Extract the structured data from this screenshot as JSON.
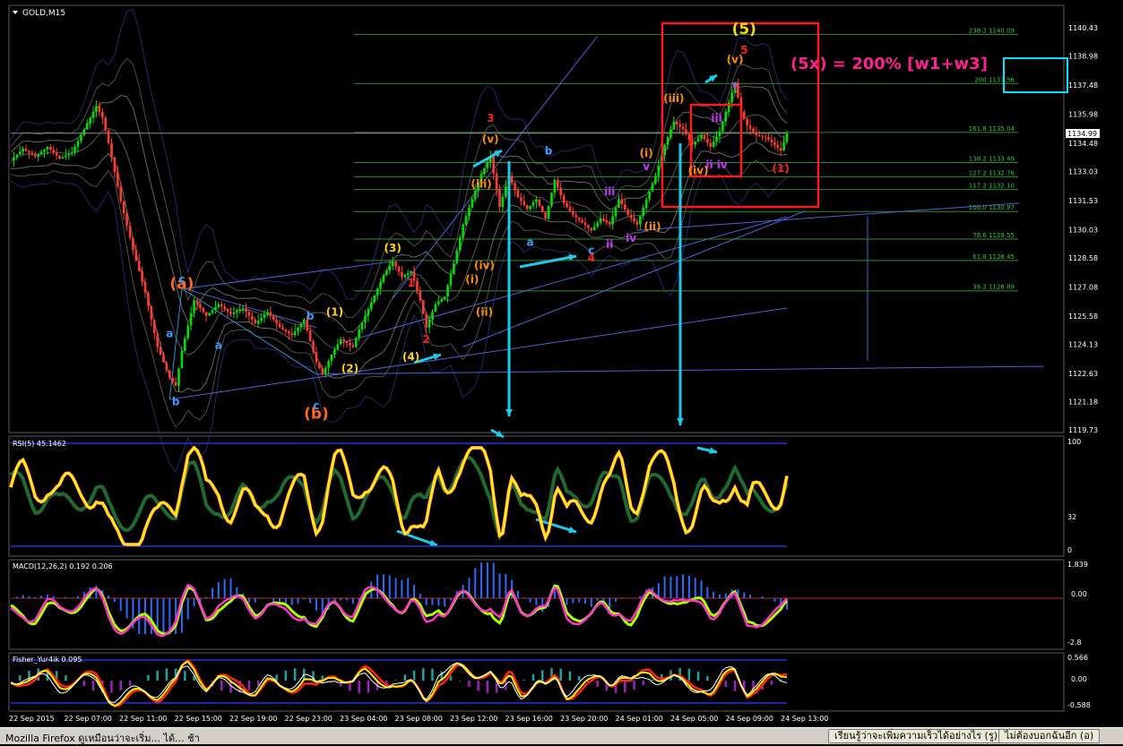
{
  "chart_data": {
    "type": "candlestick",
    "symbol": "GOLD,M15",
    "price_axis": {
      "range": [
        1119.73,
        1140.43
      ],
      "ticks": [
        "1140.43",
        "1138.98",
        "1137.48",
        "1135.98",
        "1134.48",
        "1133.03",
        "1131.53",
        "1130.03",
        "1128.58",
        "1127.08",
        "1125.58",
        "1124.13",
        "1122.63",
        "1121.18",
        "1119.73"
      ],
      "current_price": "1134.99"
    },
    "time_axis": [
      "22 Sep 2015",
      "22 Sep 07:00",
      "22 Sep 11:00",
      "22 Sep 15:00",
      "22 Sep 19:00",
      "22 Sep 23:00",
      "23 Sep 04:00",
      "23 Sep 08:00",
      "23 Sep 12:00",
      "23 Sep 16:00",
      "23 Sep 20:00",
      "24 Sep 01:00",
      "24 Sep 05:00",
      "24 Sep 09:00",
      "24 Sep 13:00"
    ],
    "close_path": [
      [
        0,
        1133.6
      ],
      [
        4,
        1134.2
      ],
      [
        8,
        1133.8
      ],
      [
        12,
        1134.3
      ],
      [
        16,
        1133.7
      ],
      [
        20,
        1134.0
      ],
      [
        24,
        1135.2
      ],
      [
        28,
        1136.4
      ],
      [
        30,
        1135.8
      ],
      [
        32,
        1134.5
      ],
      [
        36,
        1131.5
      ],
      [
        40,
        1129.0
      ],
      [
        44,
        1126.8
      ],
      [
        48,
        1124.0
      ],
      [
        52,
        1122.4
      ],
      [
        54,
        1122.0
      ],
      [
        56,
        1123.8
      ],
      [
        60,
        1126.4
      ],
      [
        64,
        1125.6
      ],
      [
        68,
        1126.2
      ],
      [
        72,
        1125.7
      ],
      [
        76,
        1126.0
      ],
      [
        80,
        1125.2
      ],
      [
        84,
        1125.8
      ],
      [
        88,
        1125.0
      ],
      [
        92,
        1124.6
      ],
      [
        96,
        1125.4
      ],
      [
        100,
        1123.2
      ],
      [
        102,
        1122.6
      ],
      [
        105,
        1123.6
      ],
      [
        108,
        1124.4
      ],
      [
        112,
        1124.0
      ],
      [
        114,
        1124.9
      ],
      [
        118,
        1126.3
      ],
      [
        122,
        1127.7
      ],
      [
        125,
        1128.4
      ],
      [
        128,
        1127.6
      ],
      [
        131,
        1127.9
      ],
      [
        134,
        1126.4
      ],
      [
        136,
        1125.0
      ],
      [
        139,
        1126.2
      ],
      [
        142,
        1126.6
      ],
      [
        145,
        1128.3
      ],
      [
        148,
        1130.3
      ],
      [
        151,
        1131.6
      ],
      [
        154,
        1132.9
      ],
      [
        157,
        1133.8
      ],
      [
        160,
        1131.2
      ],
      [
        163,
        1132.8
      ],
      [
        166,
        1131.7
      ],
      [
        169,
        1131.1
      ],
      [
        172,
        1131.6
      ],
      [
        175,
        1130.6
      ],
      [
        178,
        1132.6
      ],
      [
        181,
        1131.4
      ],
      [
        184,
        1130.8
      ],
      [
        187,
        1130.4
      ],
      [
        190,
        1130.0
      ],
      [
        193,
        1130.6
      ],
      [
        196,
        1130.3
      ],
      [
        199,
        1131.6
      ],
      [
        202,
        1130.8
      ],
      [
        205,
        1130.3
      ],
      [
        208,
        1131.6
      ],
      [
        211,
        1132.8
      ],
      [
        214,
        1134.4
      ],
      [
        217,
        1135.6
      ],
      [
        220,
        1135.2
      ],
      [
        223,
        1134.4
      ],
      [
        226,
        1134.9
      ],
      [
        229,
        1134.3
      ],
      [
        232,
        1135.1
      ],
      [
        235,
        1136.6
      ],
      [
        237,
        1137.6
      ],
      [
        239,
        1136.1
      ],
      [
        241,
        1135.4
      ],
      [
        244,
        1134.9
      ],
      [
        247,
        1134.8
      ],
      [
        250,
        1134.4
      ],
      [
        252,
        1134.1
      ],
      [
        254,
        1135.0
      ]
    ],
    "fib_levels": [
      {
        "label": "238.2",
        "value": "1140.09"
      },
      {
        "label": "200",
        "value": "1137.56"
      },
      {
        "label": "161.8",
        "value": "1135.04"
      },
      {
        "label": "138.2",
        "value": "1133.49"
      },
      {
        "label": "127.2",
        "value": "1132.76"
      },
      {
        "label": "117.2",
        "value": "1132.10"
      },
      {
        "label": "100.0",
        "value": "1130.97"
      },
      {
        "label": "78.6",
        "value": "1129.55"
      },
      {
        "label": "61.8",
        "value": "1128.45"
      },
      {
        "label": "38.2",
        "value": "1126.89"
      }
    ],
    "wave_labels": [
      {
        "text": "(a)",
        "at": [
          56,
          1127.0
        ],
        "color": "#ff6a1a"
      },
      {
        "text": "(b)",
        "at": [
          100,
          1120.3
        ],
        "color": "#ff6a1a"
      },
      {
        "text": "(5)",
        "at": [
          240,
          1140.1
        ],
        "color": "#ffd400"
      },
      {
        "text": "5",
        "at": [
          240,
          1139.1
        ],
        "color": "#ff2020"
      },
      {
        "text": "3",
        "at": [
          157,
          1135.6
        ],
        "color": "#ff2020"
      },
      {
        "text": "4",
        "at": [
          190,
          1128.4
        ],
        "color": "#ff2020"
      },
      {
        "text": "2",
        "at": [
          136,
          1124.2
        ],
        "color": "#ff2020"
      },
      {
        "text": "1",
        "at": [
          131,
          1127.1
        ],
        "color": "#ff2020"
      },
      {
        "text": "(1)",
        "at": [
          106,
          1125.6
        ],
        "color": "#ffd400"
      },
      {
        "text": "(2)",
        "at": [
          111,
          1122.7
        ],
        "color": "#ffd400"
      },
      {
        "text": "(3)",
        "at": [
          125,
          1128.9
        ],
        "color": "#ffd400"
      },
      {
        "text": "(4)",
        "at": [
          131,
          1123.3
        ],
        "color": "#ffd400"
      },
      {
        "text": "(1)",
        "at": [
          252,
          1133.0
        ],
        "color": "#ff2020"
      },
      {
        "text": "a",
        "at": [
          52,
          1124.5
        ],
        "color": "#3a9bff"
      },
      {
        "text": "b",
        "at": [
          54,
          1121.0
        ],
        "color": "#3a9bff"
      },
      {
        "text": "c",
        "at": [
          56,
          1127.3
        ],
        "color": "#3a9bff"
      },
      {
        "text": "a",
        "at": [
          68,
          1123.9
        ],
        "color": "#3a9bff"
      },
      {
        "text": "b",
        "at": [
          98,
          1125.4
        ],
        "color": "#3a9bff"
      },
      {
        "text": "c",
        "at": [
          100,
          1120.8
        ],
        "color": "#3a9bff"
      },
      {
        "text": "a",
        "at": [
          170,
          1129.2
        ],
        "color": "#3a9bff"
      },
      {
        "text": "b",
        "at": [
          176,
          1133.9
        ],
        "color": "#3a9bff"
      },
      {
        "text": "c",
        "at": [
          190,
          1128.8
        ],
        "color": "#3a9bff"
      },
      {
        "text": "(i)",
        "at": [
          151,
          1127.3
        ],
        "color": "#ff8c00"
      },
      {
        "text": "(ii)",
        "at": [
          155,
          1125.6
        ],
        "color": "#ff8c00"
      },
      {
        "text": "(iii)",
        "at": [
          154,
          1132.2
        ],
        "color": "#ff8c00"
      },
      {
        "text": "(iv)",
        "at": [
          155,
          1128.0
        ],
        "color": "#ff8c00"
      },
      {
        "text": "(v)",
        "at": [
          157,
          1134.5
        ],
        "color": "#ff8c00"
      },
      {
        "text": "(i)",
        "at": [
          208,
          1133.8
        ],
        "color": "#ff8c00"
      },
      {
        "text": "(ii)",
        "at": [
          210,
          1130.0
        ],
        "color": "#ff8c00"
      },
      {
        "text": "(iii)",
        "at": [
          217,
          1136.6
        ],
        "color": "#ff8c00"
      },
      {
        "text": "(iv)",
        "at": [
          225,
          1132.9
        ],
        "color": "#ff8c00"
      },
      {
        "text": "(v)",
        "at": [
          237,
          1138.6
        ],
        "color": "#ff8c00"
      },
      {
        "text": "iii",
        "at": [
          196,
          1131.8
        ],
        "color": "#cc33ff"
      },
      {
        "text": "iv",
        "at": [
          203,
          1129.4
        ],
        "color": "#cc33ff"
      },
      {
        "text": "ii",
        "at": [
          196,
          1129.1
        ],
        "color": "#cc33ff"
      },
      {
        "text": "v",
        "at": [
          208,
          1133.1
        ],
        "color": "#cc33ff"
      },
      {
        "text": "iii",
        "at": [
          231,
          1135.6
        ],
        "color": "#cc33ff"
      },
      {
        "text": "v",
        "at": [
          237,
          1137.3
        ],
        "color": "#cc33ff"
      },
      {
        "text": "ii iv",
        "at": [
          231,
          1133.2
        ],
        "color": "#cc33ff"
      }
    ],
    "annotation": {
      "text": "(5x) = 200% [w1+w3]",
      "color": "#ff2090"
    },
    "indicators": [
      {
        "name": "RSI(5) 45.1462",
        "ticks": [
          "100",
          "32",
          "0"
        ]
      },
      {
        "name": "MACD(12,26,2) 0.192 0.206",
        "ticks": [
          "1.839",
          "0.00",
          "-2.8"
        ]
      },
      {
        "name": "Fisher_Yur4ik 0.095",
        "ticks": [
          "0.566",
          "0.00",
          "-0.588"
        ]
      }
    ]
  },
  "statusbar": {
    "text": "Mozilla Firefox ดูเหมือนว่าจะเริ่ม... ได้... ช้า",
    "learn_button": "เรียนรู้ว่าจะเพิ่มความเร็วได้อย่างไร (รู)",
    "dismiss_button": "ไม่ต้องบอกฉันอีก (อ)"
  }
}
